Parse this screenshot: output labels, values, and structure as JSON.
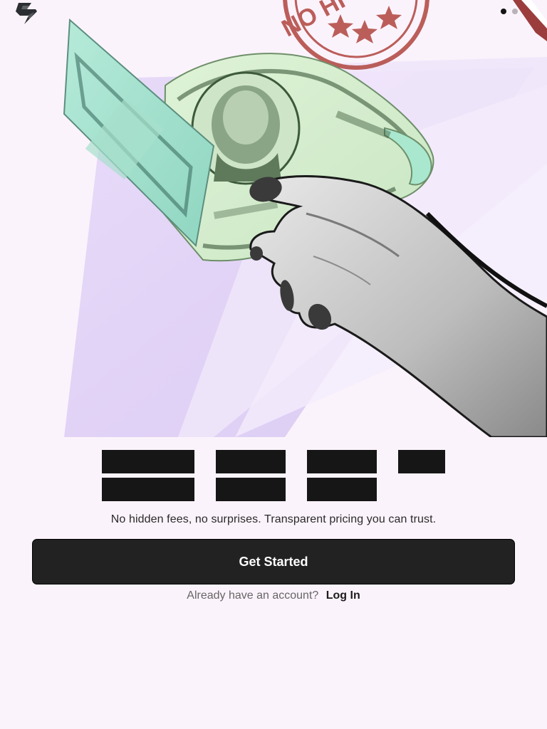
{
  "app": {
    "logo_icon": "s-shield-logo-icon"
  },
  "pager": {
    "count": 2,
    "active_index": 0
  },
  "hero": {
    "stamp_text": "NO HI",
    "image_description_icon": "hand-holding-dollar-bill-illustration"
  },
  "onboarding": {
    "subtitle": "No hidden fees, no surprises. Transparent pricing you can trust.",
    "primary_button_label": "Get Started",
    "login_prompt": "Already have an account?",
    "login_link_label": "Log In"
  },
  "colors": {
    "background": "#fbf3fb",
    "button": "#222222",
    "accent_purple": "#dccbf5",
    "stamp_red": "#b0453f"
  }
}
